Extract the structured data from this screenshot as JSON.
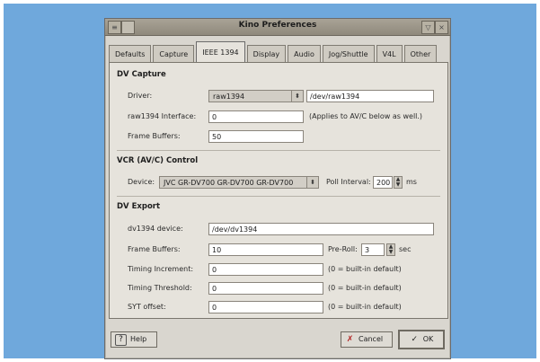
{
  "window": {
    "title": "Kino Preferences",
    "menu_glyph": "≡",
    "minimize_glyph": "▽",
    "close_glyph": "×"
  },
  "tabs": [
    "Defaults",
    "Capture",
    "IEEE 1394",
    "Display",
    "Audio",
    "Jog/Shuttle",
    "V4L",
    "Other"
  ],
  "dv_capture": {
    "section": "DV Capture",
    "driver_label": "Driver:",
    "driver_value": "raw1394",
    "driver_path": "/dev/raw1394",
    "interface_label": "raw1394 Interface:",
    "interface_value": "0",
    "interface_note": "(Applies to AV/C below as well.)",
    "buffers_label": "Frame Buffers:",
    "buffers_value": "50"
  },
  "vcr_control": {
    "section": "VCR (AV/C) Control",
    "device_label": "Device:",
    "device_value": "JVC GR-DV700 GR-DV700 GR-DV700",
    "poll_label": "Poll Interval:",
    "poll_value": "200",
    "poll_unit": "ms"
  },
  "dv_export": {
    "section": "DV Export",
    "device_label": "dv1394 device:",
    "device_value": "/dev/dv1394",
    "buffers_label": "Frame Buffers:",
    "buffers_value": "10",
    "preroll_label": "Pre-Roll:",
    "preroll_value": "3",
    "preroll_unit": "sec",
    "timing_inc_label": "Timing Increment:",
    "timing_inc_value": "0",
    "timing_thr_label": "Timing Threshold:",
    "timing_thr_value": "0",
    "syt_label": "SYT offset:",
    "syt_value": "0",
    "default_note": "(0 = built-in default)"
  },
  "buttons": {
    "help": "Help",
    "cancel": "Cancel",
    "ok": "OK"
  },
  "icons": {
    "combo_arrow": "⬍",
    "spin_up": "▲",
    "spin_down": "▼",
    "help_icon": "?",
    "cancel_icon": "✗",
    "ok_icon": "✓"
  }
}
